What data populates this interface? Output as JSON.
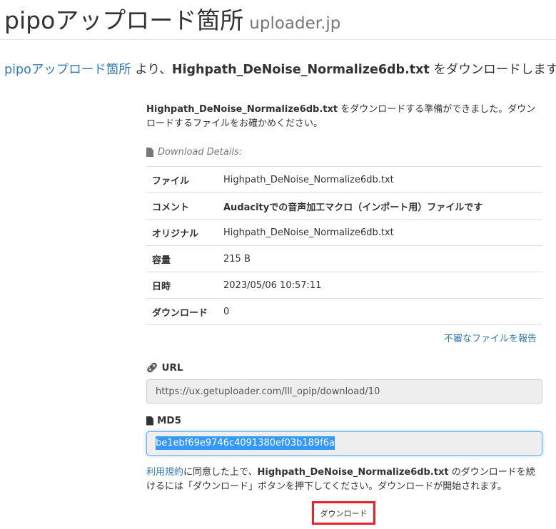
{
  "header": {
    "title": "pipoアップロード箇所",
    "subtitle": "uploader.jp"
  },
  "lead": {
    "site_link": "pipoアップロード箇所",
    "text1": " より、",
    "filename": "Highpath_DeNoise_Normalize6db.txt",
    "text2": " をダウンロードします。"
  },
  "ready": {
    "filename": "Highpath_DeNoise_Normalize6db.txt",
    "text": " をダウンロードする準備ができました。ダウンロードするファイルをお確かめください。"
  },
  "details": {
    "caption": "Download Details:",
    "rows": [
      {
        "key": "ファイル",
        "value": "Highpath_DeNoise_Normalize6db.txt"
      },
      {
        "key": "コメント",
        "value": "Audacityでの音声加工マクロ（インポート用）ファイルです"
      },
      {
        "key": "オリジナル",
        "value": "Highpath_DeNoise_Normalize6db.txt"
      },
      {
        "key": "容量",
        "value": "215 B"
      },
      {
        "key": "日時",
        "value": "2023/05/06 10:57:11"
      },
      {
        "key": "ダウンロード",
        "value": "0"
      }
    ],
    "report_link": "不審なファイルを報告"
  },
  "url": {
    "label": "URL",
    "value": "https://ux.getuploader.com/lll_opip/download/10"
  },
  "md5": {
    "label": "MD5",
    "value": "be1ebf69e9746c4091380ef03b189f6a"
  },
  "agree": {
    "terms_link": "利用規約",
    "text1": "に同意した上で、",
    "filename": "Highpath_DeNoise_Normalize6db.txt",
    "text2": " のダウンロードを続けるには「ダウンロード」ボタンを押下してください。ダウンロードが開始されます。"
  },
  "download_button": "ダウンロード",
  "colors": {
    "link": "#337ab7",
    "highlight_border": "#e8202a",
    "selection": "#3399ff"
  }
}
